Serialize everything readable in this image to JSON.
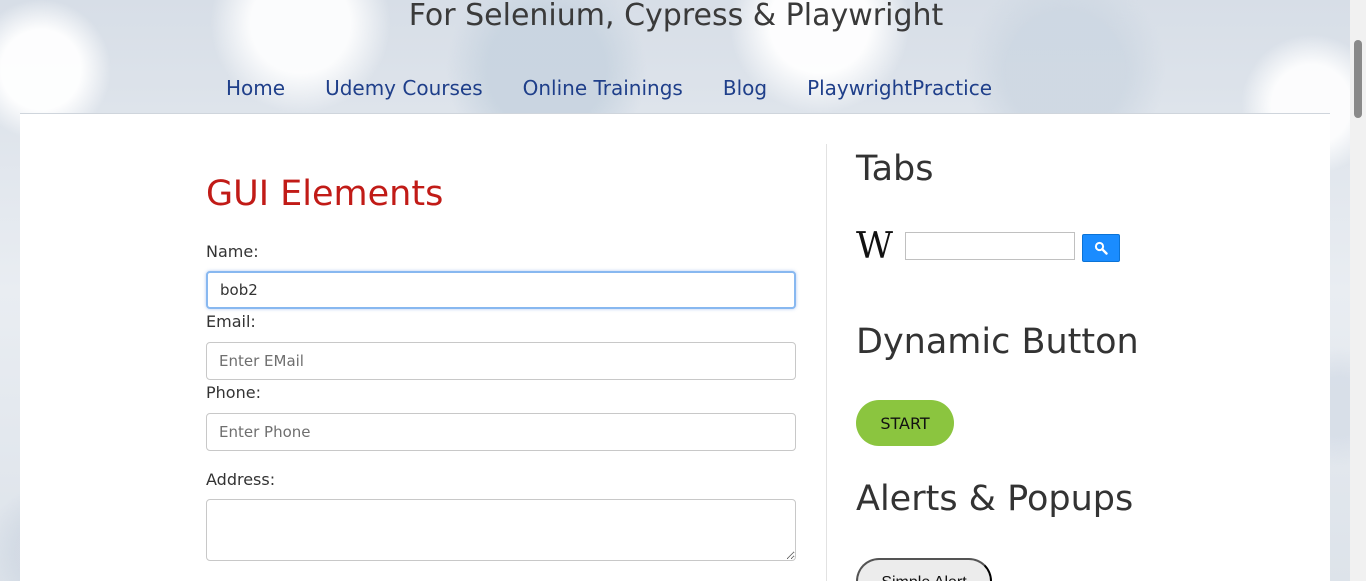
{
  "header": {
    "subtitle": "For Selenium, Cypress & Playwright"
  },
  "nav": {
    "items": [
      {
        "label": "Home"
      },
      {
        "label": "Udemy Courses"
      },
      {
        "label": "Online Trainings"
      },
      {
        "label": "Blog"
      },
      {
        "label": "PlaywrightPractice"
      }
    ]
  },
  "gui_elements": {
    "title": "GUI Elements",
    "name_label": "Name:",
    "name_value": "bob2",
    "email_label": "Email:",
    "email_placeholder": "Enter EMail",
    "phone_label": "Phone:",
    "phone_placeholder": "Enter Phone",
    "address_label": "Address:"
  },
  "tabs": {
    "title": "Tabs",
    "wiki_logo": "W"
  },
  "dynamic_button": {
    "title": "Dynamic Button",
    "start_label": "START"
  },
  "alerts": {
    "title": "Alerts & Popups",
    "simple_alert_label": "Simple Alert"
  },
  "colors": {
    "accent_red": "#c11b17",
    "link_blue": "#1f3f8a",
    "start_green": "#8bc53f",
    "wiki_search_blue": "#1a8cff"
  }
}
